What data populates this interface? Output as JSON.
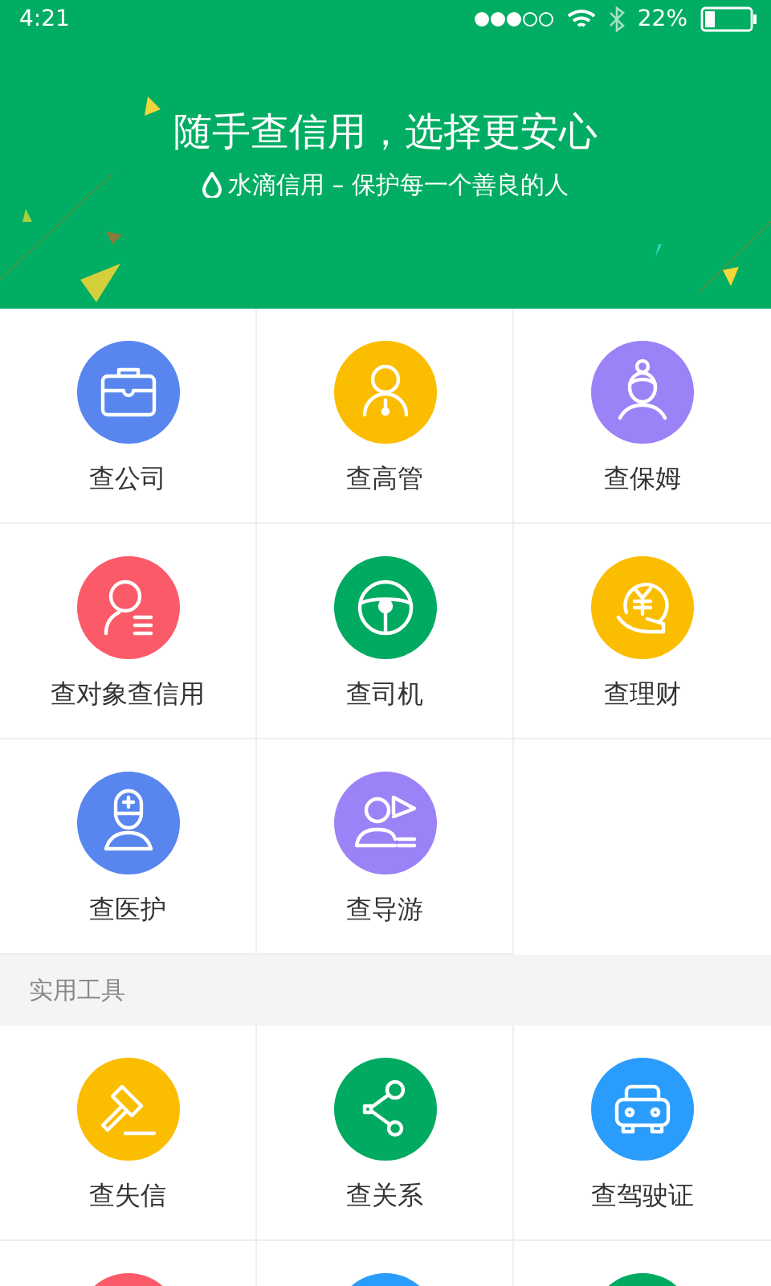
{
  "status_bar": {
    "time": "4:21",
    "battery": "22%"
  },
  "banner": {
    "title": "随手查信用，选择更安心",
    "subtitle": "水滴信用 – 保护每一个善良的人"
  },
  "services": [
    {
      "label": "查公司",
      "kind": "briefcase",
      "color": "#5886ee"
    },
    {
      "label": "查高管",
      "kind": "manager",
      "color": "#fbbd00"
    },
    {
      "label": "查保姆",
      "kind": "nanny",
      "color": "#9b82f7"
    },
    {
      "label": "查对象查信用",
      "kind": "person-list",
      "color": "#fb5a68"
    },
    {
      "label": "查司机",
      "kind": "steering",
      "color": "#00aa60"
    },
    {
      "label": "查理财",
      "kind": "money-hand",
      "color": "#fbbd00"
    },
    {
      "label": "查医护",
      "kind": "nurse",
      "color": "#5886ee"
    },
    {
      "label": "查导游",
      "kind": "guide",
      "color": "#9b82f7"
    }
  ],
  "tools_section": {
    "title": "实用工具"
  },
  "tools": [
    {
      "label": "查失信",
      "kind": "gavel",
      "color": "#fbbd00"
    },
    {
      "label": "查关系",
      "kind": "share",
      "color": "#00aa60"
    },
    {
      "label": "查驾驶证",
      "kind": "car",
      "color": "#2a9cfb"
    }
  ],
  "partial_tools": [
    {
      "color": "#fb5a68"
    },
    {
      "color": "#2a9cfb"
    },
    {
      "color": "#00aa60"
    }
  ]
}
